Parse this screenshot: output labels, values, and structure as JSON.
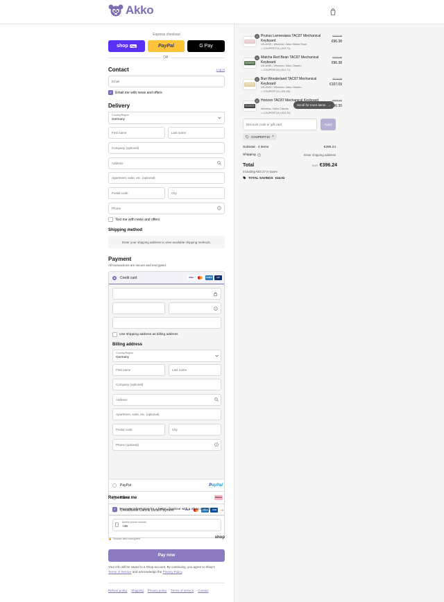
{
  "brand": {
    "name": "Akko",
    "color": "#7e6cb5"
  },
  "express": {
    "title": "Express checkout",
    "shop_pay": "shop",
    "shop_pay_badge": "Pay",
    "paypal": "PayPal",
    "gpay": "G Pay",
    "or": "OR"
  },
  "contact": {
    "heading": "Contact",
    "login_link": "Log in",
    "email_placeholder": "Email",
    "email_news": "Email me with news and offers"
  },
  "delivery": {
    "heading": "Delivery",
    "country_label": "Country/Region",
    "country_value": "Germany",
    "first_name": "First name",
    "last_name": "Last name",
    "company": "Company (optional)",
    "address": "Address",
    "apartment": "Apartment, suite, etc. (optional)",
    "postal": "Postal code",
    "city": "City",
    "phone": "Phone",
    "text_news": "Text me with news and offers"
  },
  "shipping_method": {
    "heading": "Shipping method",
    "notice": "Enter your shipping address to view available shipping methods."
  },
  "payment": {
    "heading": "Payment",
    "subtitle": "All transactions are secure and encrypted.",
    "credit_card": "Credit card",
    "use_shipping_billing": "Use shipping address as billing address",
    "paypal": "PayPal",
    "klarna": "Klarna",
    "local": "Credit/Debit Card & Local Payment",
    "more_cards": "+3"
  },
  "billing": {
    "heading": "Billing address",
    "country_label": "Country/Region",
    "country_value": "Germany",
    "first_name": "First name",
    "last_name": "Last name",
    "company": "Company (optional)",
    "address": "Address",
    "apartment": "Apartment, suite, etc. (optional)",
    "postal": "Postal code",
    "city": "City",
    "phone": "Phone (optional)"
  },
  "remember": {
    "heading": "Remember me",
    "save_info": "Save my information for a faster checkout with a Shop account",
    "mobile_label": "Mobile phone number",
    "mobile_value": "+49",
    "secure": "Secure and encrypted",
    "shop": "shop"
  },
  "pay_now": "Pay now",
  "legal": {
    "text1": "Your info will be saved to a Shop account. By continuing, you agree to Shop's",
    "tos": "Terms of Service",
    "text2": "and acknowledge the",
    "privacy": "Privacy Policy",
    "end": "."
  },
  "footer": [
    "Refund policy",
    "Shipping",
    "Privacy policy",
    "Terms of service",
    "Contact"
  ],
  "cart": {
    "items": [
      {
        "qty": "1",
        "name": "Prunus Lannesiana TAC87 Mechanical Keyboard",
        "variant": "US-ANSI / Wireless / Akko Stellar Rose",
        "discount": "COUPERT10 (-€10.71)",
        "old": "€107.09",
        "price": "€96.38",
        "color": "#e8c6c9"
      },
      {
        "qty": "1",
        "name": "Matcha Red Bean TAC87 Mechanical Keyboard",
        "variant": "US-ANSI / Wireless / Akko Cilantro",
        "discount": "COUPERT10 (-€10.71)",
        "old": "€107.09",
        "price": "€96.38",
        "color": "#4e6b46"
      },
      {
        "qty": "1",
        "name": "Bun Wonderland TAC87 Mechanical Keyboard",
        "variant": "US-ANSI / Wireless / Akko Cilantro",
        "discount": "COUPERT10 (-€11.90)",
        "old": "€118.99",
        "price": "€107.09",
        "color": "#e3c99a"
      },
      {
        "qty": "1",
        "name": "Horizon TAC87 Mechanical Keyboard",
        "variant": "Wireless / Akko Cilantro",
        "discount": "COUPERT10 (-€10.70)",
        "old": "€107.00",
        "price": "€96.30",
        "color": "#3a3a3a"
      }
    ],
    "scroll_hint": "Scroll for more items",
    "discount_placeholder": "Discount code or gift card",
    "apply": "Apply",
    "coupon": "COUPERT10",
    "subtotal_label": "Subtotal · 4 items",
    "subtotal": "€396.24",
    "shipping_label": "Shipping",
    "shipping_value": "Enter shipping address",
    "total_label": "Total",
    "currency": "EUR",
    "total": "€396.24",
    "taxes": "Including €63.27 in taxes",
    "savings_label": "TOTAL SAVINGS",
    "savings": "€44.02"
  }
}
